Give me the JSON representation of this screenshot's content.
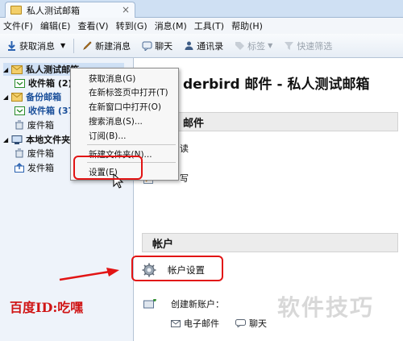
{
  "tab": {
    "title": "私人测试邮箱",
    "close": "×"
  },
  "menubar": [
    "文件(F)",
    "编辑(E)",
    "查看(V)",
    "转到(G)",
    "消息(M)",
    "工具(T)",
    "帮助(H)"
  ],
  "toolbar": {
    "get_mail": "获取消息",
    "new_mail": "新建消息",
    "chat": "聊天",
    "address_book": "通讯录",
    "tags": "标签",
    "quick_filter": "快速筛选"
  },
  "folders": {
    "account1": "私人测试邮箱",
    "account1_inbox": "收件箱 (2)",
    "account2": "备份邮箱",
    "account2_inbox": "收件箱 (372)",
    "trash": "废件箱",
    "local": "本地文件夹",
    "local_trash": "废件箱",
    "outbox": "发件箱"
  },
  "main": {
    "title": "derbird 邮件 - 私人测试邮箱",
    "mail_section": "邮件",
    "read": "读",
    "write": "写",
    "account_section": "帐户",
    "account_settings": "帐户设置",
    "create_account": "创建新账户：",
    "email": "电子邮件",
    "chat": "聊天"
  },
  "context_menu": {
    "items": [
      "获取消息(G)",
      "在新标签页中打开(T)",
      "在新窗口中打开(O)",
      "搜索消息(S)...",
      "订阅(B)...",
      "新建文件夹(N)...",
      "设置(E)"
    ]
  },
  "annotations": {
    "watermark": "百度ID:吃嘿",
    "watermark2": "软件技巧"
  },
  "colors": {
    "accent_red": "#e21414",
    "selection": "#cfe0f5"
  }
}
